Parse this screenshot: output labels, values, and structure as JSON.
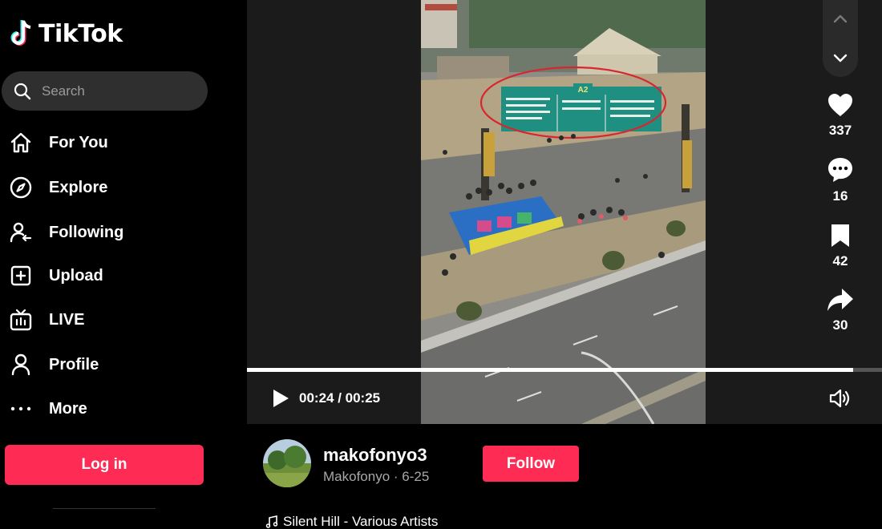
{
  "app": {
    "name": "TikTok"
  },
  "search": {
    "placeholder": "Search"
  },
  "nav": [
    {
      "label": "For You",
      "icon": "home-icon"
    },
    {
      "label": "Explore",
      "icon": "compass-icon"
    },
    {
      "label": "Following",
      "icon": "following-icon"
    },
    {
      "label": "Upload",
      "icon": "upload-icon"
    },
    {
      "label": "LIVE",
      "icon": "live-icon"
    },
    {
      "label": "Profile",
      "icon": "profile-icon"
    },
    {
      "label": "More",
      "icon": "more-icon"
    }
  ],
  "login": {
    "label": "Log in"
  },
  "player": {
    "time": "00:24 / 00:25",
    "progress": 0.955,
    "sign_text": "A2"
  },
  "actions": {
    "likes": "337",
    "comments": "16",
    "saves": "42",
    "shares": "30"
  },
  "creator": {
    "username": "makofonyo3",
    "subline": "Makofonyo · 6-25",
    "follow_label": "Follow"
  },
  "music": {
    "title": "Silent Hill - Various Artists"
  },
  "colors": {
    "accent": "#fe2c55",
    "background": "#000000",
    "player_bg": "#1b1b1b"
  }
}
